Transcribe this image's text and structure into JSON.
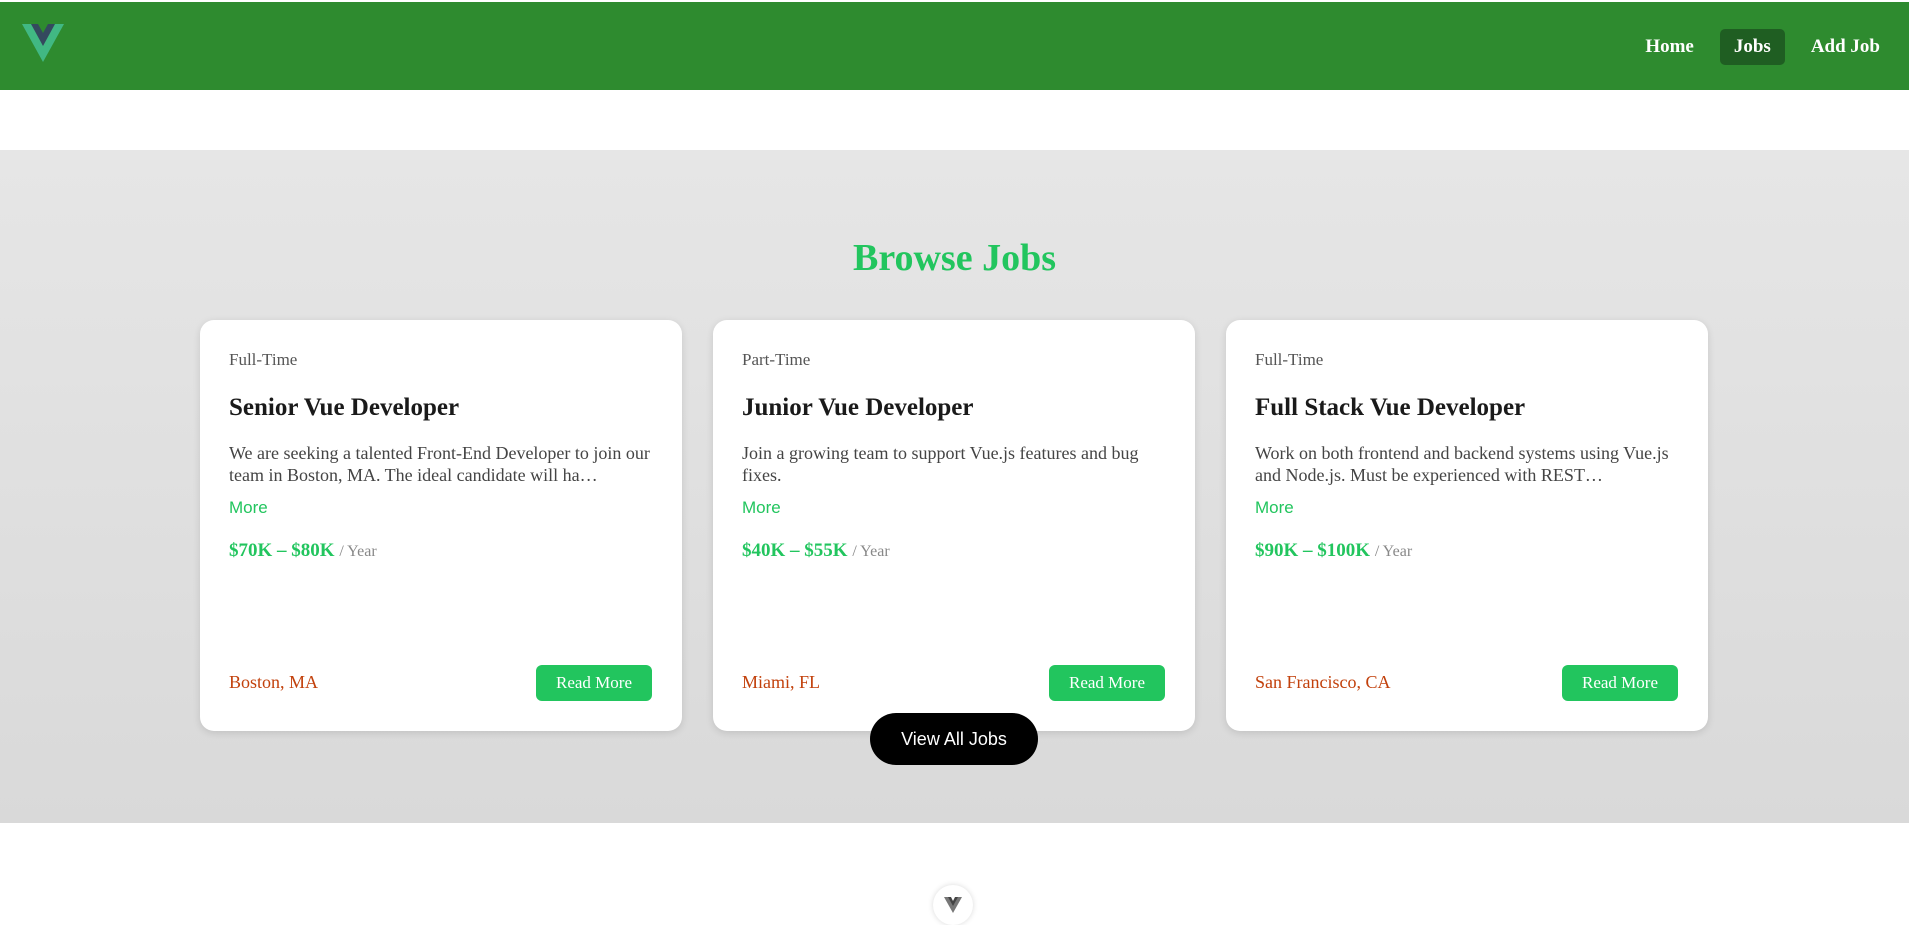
{
  "brand": {
    "logo_icon": "vue-logo-icon",
    "colors": {
      "header": "#2e8b2f",
      "accent": "#22c55e",
      "location": "#c2410c"
    }
  },
  "nav": {
    "items": [
      {
        "label": "Home"
      },
      {
        "label": "Jobs"
      },
      {
        "label": "Add Job"
      }
    ],
    "active": "Jobs"
  },
  "browse": {
    "title": "Browse Jobs",
    "view_all_label": "View All Jobs"
  },
  "jobs": [
    {
      "type": "Full-Time",
      "title": "Senior Vue Developer",
      "description": "We are seeking a talented Front-End Developer to join our team in Boston, MA. The ideal candidate will ha…",
      "more_label": "More",
      "salary": "$70K – $80K",
      "salary_unit": "/ Year",
      "location": "Boston, MA",
      "button_label": "Read More"
    },
    {
      "type": "Part-Time",
      "title": "Junior Vue Developer",
      "description": "Join a growing team to support Vue.js features and bug fixes.",
      "more_label": "More",
      "salary": "$40K – $55K",
      "salary_unit": "/ Year",
      "location": "Miami, FL",
      "button_label": "Read More"
    },
    {
      "type": "Full-Time",
      "title": "Full Stack Vue Developer",
      "description": "Work on both frontend and backend systems using Vue.js and Node.js. Must be experienced with REST…",
      "more_label": "More",
      "salary": "$90K – $100K",
      "salary_unit": "/ Year",
      "location": "San Francisco, CA",
      "button_label": "Read More"
    }
  ],
  "footer": {
    "icon": "vue-logo-icon"
  }
}
